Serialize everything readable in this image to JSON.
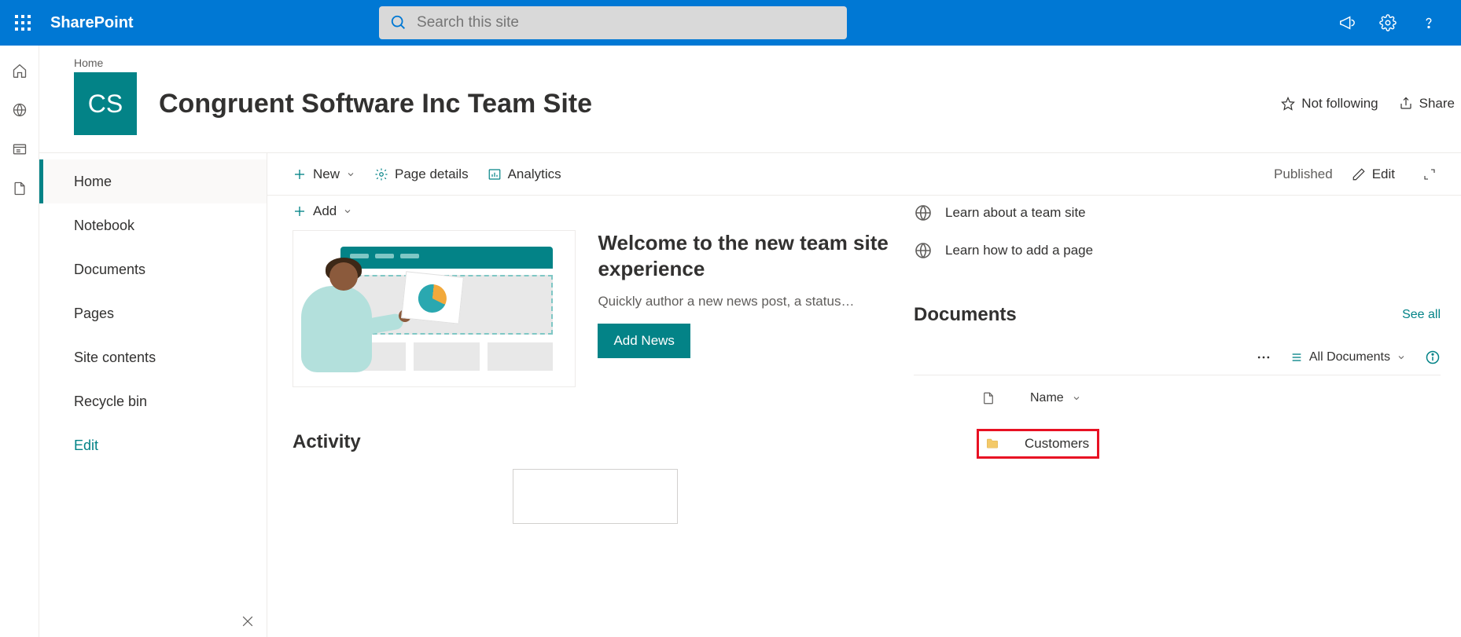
{
  "suite": {
    "app_name": "SharePoint",
    "search_placeholder": "Search this site"
  },
  "breadcrumb": "Home",
  "site": {
    "logo_initials": "CS",
    "title": "Congruent Software Inc Team Site",
    "follow_label": "Not following",
    "share_label": "Share"
  },
  "left_nav": {
    "items": [
      "Home",
      "Notebook",
      "Documents",
      "Pages",
      "Site contents",
      "Recycle bin"
    ],
    "edit_label": "Edit"
  },
  "cmdbar": {
    "new_label": "New",
    "page_details_label": "Page details",
    "analytics_label": "Analytics",
    "published_label": "Published",
    "edit_label": "Edit"
  },
  "news": {
    "add_label": "Add",
    "title": "Welcome to the new team site experience",
    "subtitle": "Quickly author a new news post, a status…",
    "button_label": "Add News"
  },
  "activity": {
    "heading": "Activity"
  },
  "tips": {
    "learn_site": "Learn about a team site",
    "learn_page": "Learn how to add a page"
  },
  "documents": {
    "heading": "Documents",
    "see_all": "See all",
    "view_label": "All Documents",
    "column_name": "Name",
    "rows": [
      {
        "name": "Customers",
        "type": "folder"
      }
    ]
  }
}
